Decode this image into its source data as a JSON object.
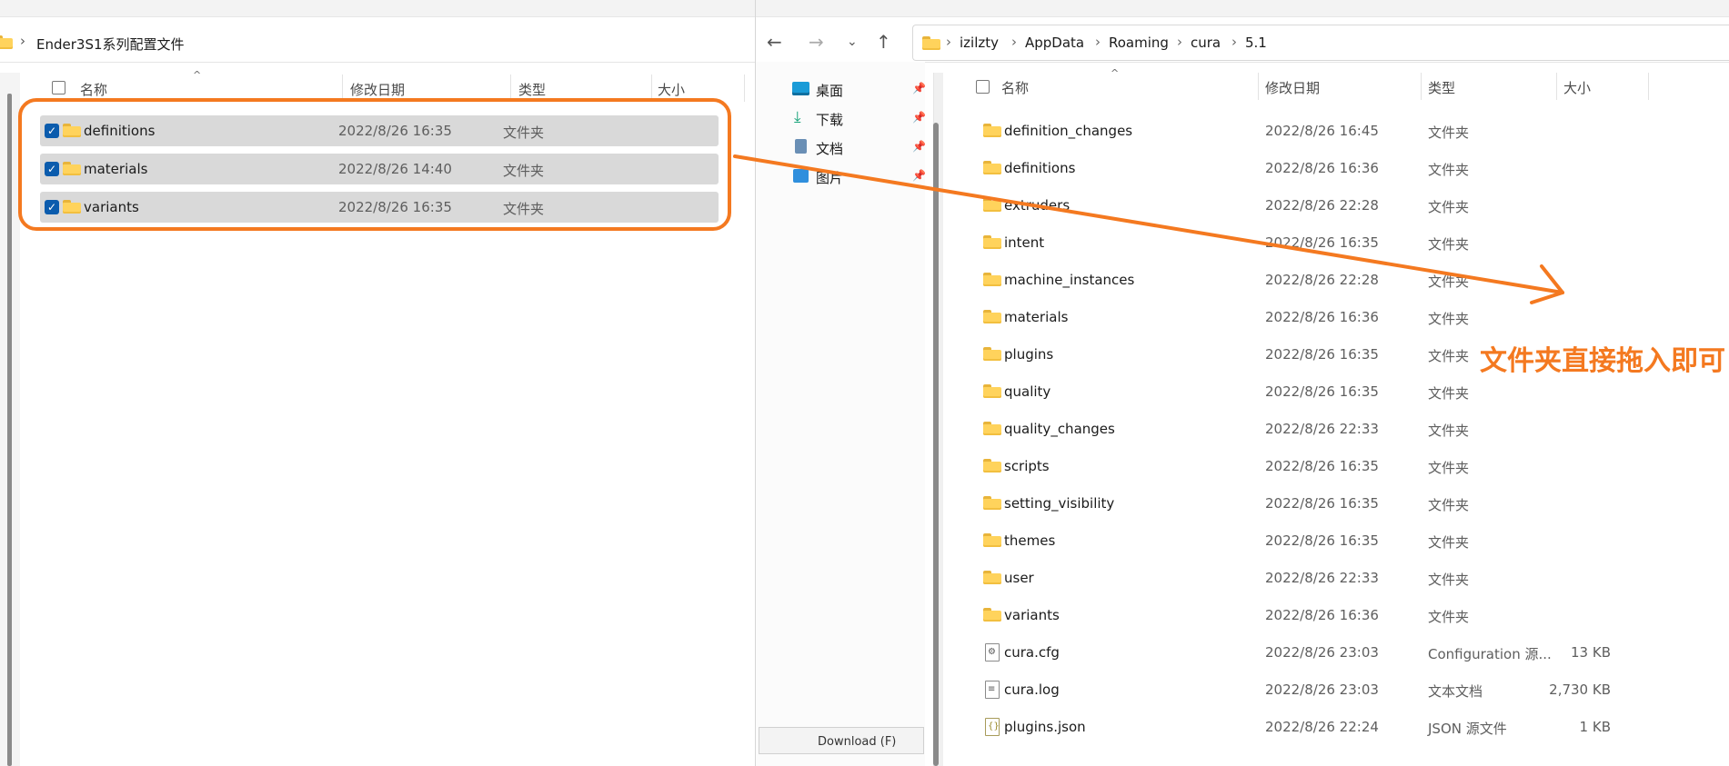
{
  "left": {
    "breadcrumb": "Ender3S1系列配置文件",
    "headers": {
      "name": "名称",
      "date": "修改日期",
      "type": "类型",
      "size": "大小"
    },
    "rows": [
      {
        "name": "definitions",
        "date": "2022/8/26 16:35",
        "type": "文件夹"
      },
      {
        "name": "materials",
        "date": "2022/8/26 14:40",
        "type": "文件夹"
      },
      {
        "name": "variants",
        "date": "2022/8/26 16:35",
        "type": "文件夹"
      }
    ]
  },
  "right": {
    "breadcrumb": [
      "izilzty",
      "AppData",
      "Roaming",
      "cura",
      "5.1"
    ],
    "nav_items": [
      {
        "label": "桌面",
        "icon": "desktop-icon"
      },
      {
        "label": "下载",
        "icon": "download-icon"
      },
      {
        "label": "文档",
        "icon": "document-icon"
      },
      {
        "label": "图片",
        "icon": "picture-icon"
      }
    ],
    "nav_partial_bottom": "Download (F)",
    "headers": {
      "name": "名称",
      "date": "修改日期",
      "type": "类型",
      "size": "大小"
    },
    "rows": [
      {
        "name": "definition_changes",
        "date": "2022/8/26 16:45",
        "type": "文件夹",
        "size": "",
        "icon": "folder-icon"
      },
      {
        "name": "definitions",
        "date": "2022/8/26 16:36",
        "type": "文件夹",
        "size": "",
        "icon": "folder-icon"
      },
      {
        "name": "extruders",
        "date": "2022/8/26 22:28",
        "type": "文件夹",
        "size": "",
        "icon": "folder-icon"
      },
      {
        "name": "intent",
        "date": "2022/8/26 16:35",
        "type": "文件夹",
        "size": "",
        "icon": "folder-icon"
      },
      {
        "name": "machine_instances",
        "date": "2022/8/26 22:28",
        "type": "文件夹",
        "size": "",
        "icon": "folder-icon"
      },
      {
        "name": "materials",
        "date": "2022/8/26 16:36",
        "type": "文件夹",
        "size": "",
        "icon": "folder-icon"
      },
      {
        "name": "plugins",
        "date": "2022/8/26 16:35",
        "type": "文件夹",
        "size": "",
        "icon": "folder-icon"
      },
      {
        "name": "quality",
        "date": "2022/8/26 16:35",
        "type": "文件夹",
        "size": "",
        "icon": "folder-icon"
      },
      {
        "name": "quality_changes",
        "date": "2022/8/26 22:33",
        "type": "文件夹",
        "size": "",
        "icon": "folder-icon"
      },
      {
        "name": "scripts",
        "date": "2022/8/26 16:35",
        "type": "文件夹",
        "size": "",
        "icon": "folder-icon"
      },
      {
        "name": "setting_visibility",
        "date": "2022/8/26 16:35",
        "type": "文件夹",
        "size": "",
        "icon": "folder-icon"
      },
      {
        "name": "themes",
        "date": "2022/8/26 16:35",
        "type": "文件夹",
        "size": "",
        "icon": "folder-icon"
      },
      {
        "name": "user",
        "date": "2022/8/26 22:33",
        "type": "文件夹",
        "size": "",
        "icon": "folder-icon"
      },
      {
        "name": "variants",
        "date": "2022/8/26 16:36",
        "type": "文件夹",
        "size": "",
        "icon": "folder-icon"
      },
      {
        "name": "cura.cfg",
        "date": "2022/8/26 23:03",
        "type": "Configuration 源...",
        "size": "13 KB",
        "icon": "config-file-icon"
      },
      {
        "name": "cura.log",
        "date": "2022/8/26 23:03",
        "type": "文本文档",
        "size": "2,730 KB",
        "icon": "text-file-icon"
      },
      {
        "name": "plugins.json",
        "date": "2022/8/26 22:24",
        "type": "JSON 源文件",
        "size": "1 KB",
        "icon": "json-file-icon"
      }
    ]
  },
  "annotation": {
    "text": "文件夹直接拖入即可",
    "color": "#f47920"
  },
  "colors": {
    "selection_bg": "#d9d9d9",
    "checkbox": "#0b5cad",
    "folder": "#ffd35c"
  }
}
